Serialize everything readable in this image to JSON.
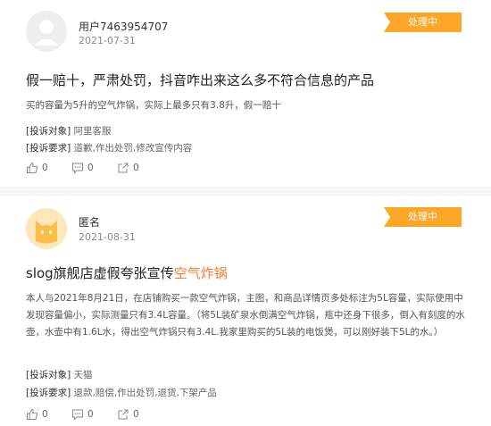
{
  "complaints": [
    {
      "user": "用户7463954707",
      "date": "2021-07-31",
      "status": "处理中",
      "title": "假一赔十，严肃处罚，抖音咋出来这么多不符合信息的产品",
      "title_accent": "",
      "summary": "买的容量为5升的空气炸锅，实际上最多只有3.8升，假一赔十",
      "target_label": "[投诉对象]",
      "target_value": "阿里客服",
      "demand_label": "[投诉要求]",
      "demand_value": "道歉,作出处罚,修改宣传内容",
      "likes": "0",
      "comments": "0",
      "shares": "0"
    },
    {
      "user": "匿名",
      "date": "2021-08-31",
      "status": "处理中",
      "title": "slog旗舰店虚假夸张宣传",
      "title_accent": "空气炸锅",
      "summary": "本人与2021年8月21日，在店铺购买一款空气炸锅，主图，和商品详情页多处标注为5L容量，实际使用中发现容量偏小，实际测量只有3.4L容量。（将5L装矿泉水倒满空气炸锅，瓶中还身下很多，倒入有刻度的水壶，水壶中有1.6L水，得出空气炸锅只有3.4L.我家里购买的5L装的电饭煲，可以刚好装下5L的水。）",
      "target_label": "[投诉对象]",
      "target_value": "天猫",
      "demand_label": "[投诉要求]",
      "demand_value": "退款,赔偿,作出处罚,退货,下架产品",
      "likes": "0",
      "comments": "0",
      "shares": "0"
    }
  ],
  "colors": {
    "badge": "#fea628",
    "accent": "#ff7a2e",
    "avatar_anonymous": "#fde7b8"
  }
}
